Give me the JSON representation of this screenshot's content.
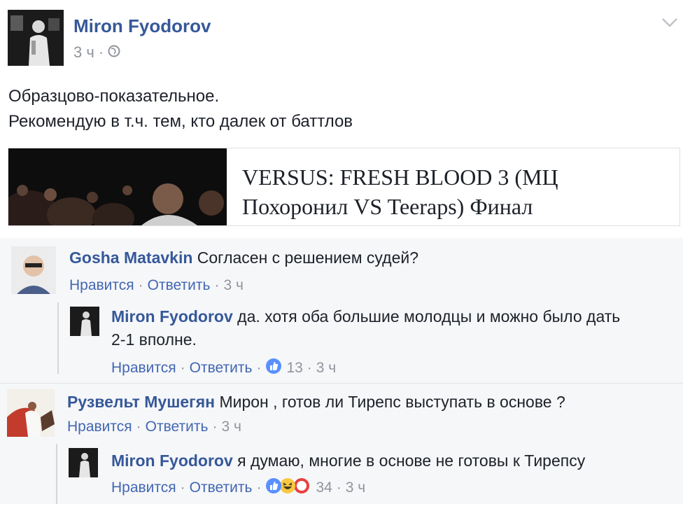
{
  "post": {
    "author": "Miron Fyodorov",
    "time": "3 ч",
    "separator": "·",
    "text_line1": "Образцово-показательное.",
    "text_line2": "Рекомендую в т.ч. тем, кто далек от баттлов",
    "link_title": "VERSUS: FRESH BLOOD 3 (МЦ Похоронил VS Teeraps) Финал"
  },
  "comments": [
    {
      "author": "Gosha Matavkin",
      "text": "Согласен с решением судей?",
      "like": "Нравится",
      "reply": "Ответить",
      "time": "3 ч",
      "reply_comment": {
        "author": "Miron Fyodorov",
        "text_line1": "да. хотя оба большие молодцы и можно было дать",
        "text_line2": "2-1 вполне.",
        "like": "Нравится",
        "reply": "Ответить",
        "reactions": "13",
        "time": "3 ч"
      }
    },
    {
      "author": "Рузвельт Мушегян",
      "text": "Мирон , готов ли Тирепс выступать в основе ?",
      "like": "Нравится",
      "reply": "Ответить",
      "time": "3 ч",
      "reply_comment": {
        "author": "Miron Fyodorov",
        "text": "я думаю, многие в основе не готовы к Тирепсу",
        "like": "Нравится",
        "reply": "Ответить",
        "reactions": "34",
        "time": "3 ч"
      }
    }
  ],
  "colors": {
    "link": "#365899",
    "action": "#4267b2",
    "meta": "#90949c",
    "comment_bg": "#f6f7f9",
    "like_blue": "#5890ff",
    "haha_yellow": "#f7c844",
    "angry_red": "#e8403f"
  },
  "icons": [
    "globe-icon",
    "chevron-down-icon",
    "like-reaction-icon",
    "haha-reaction-icon",
    "angry-reaction-icon"
  ]
}
